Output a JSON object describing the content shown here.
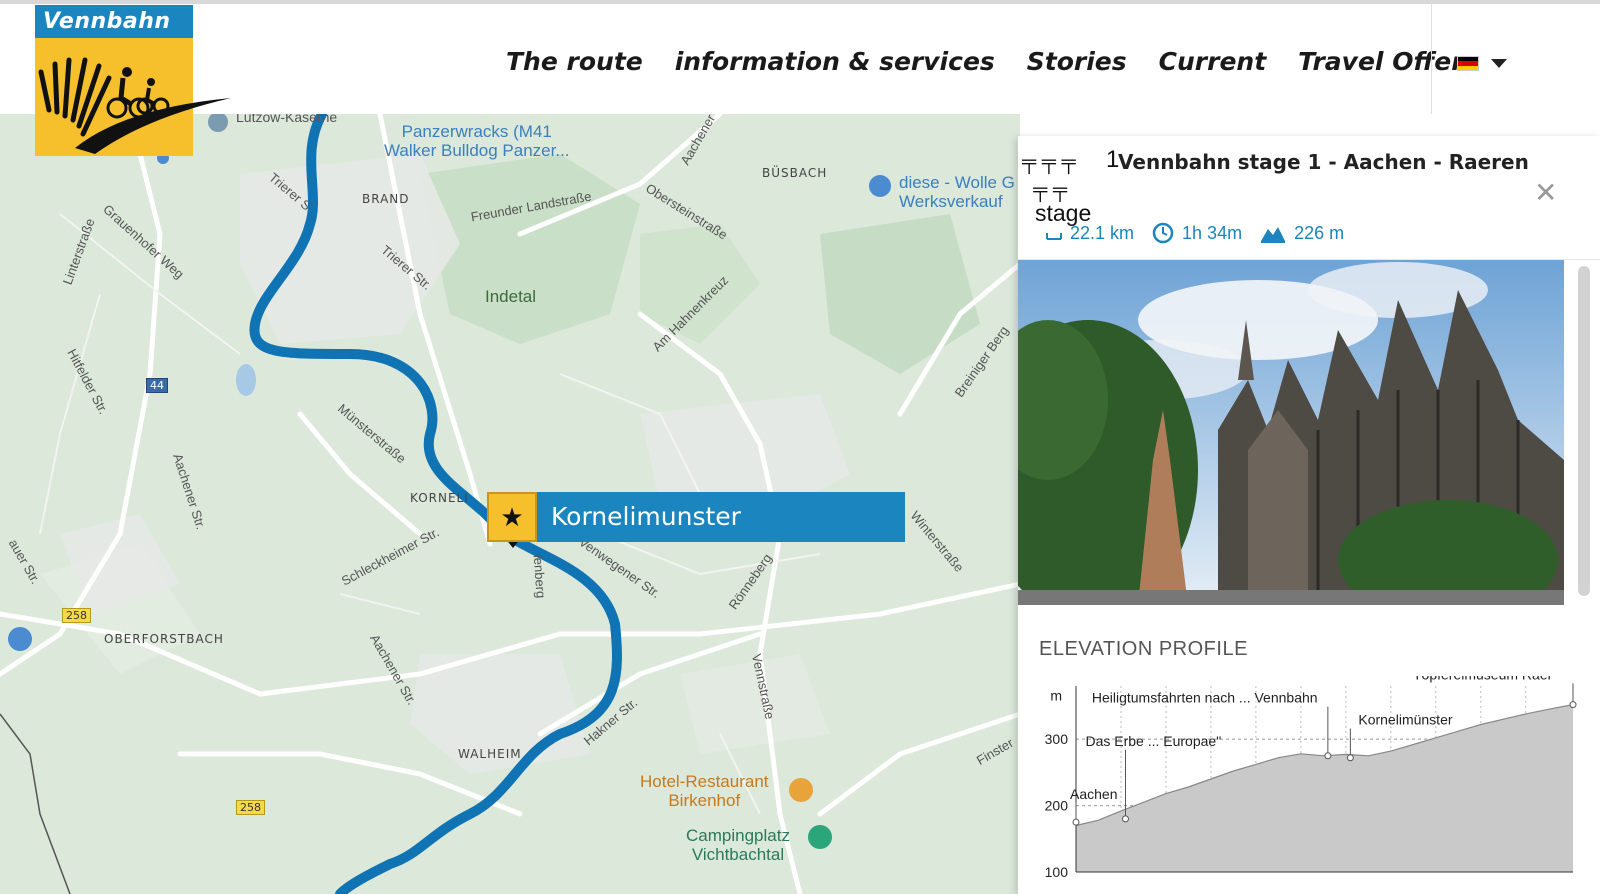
{
  "logo": {
    "text": "Vennbahn"
  },
  "nav": {
    "items": [
      "The route",
      "information & services",
      "Stories",
      "Current",
      "Travel Offers"
    ],
    "language": {
      "flag": "german-flag-icon",
      "colors": [
        "#000000",
        "#dd0000",
        "#ffce00"
      ]
    }
  },
  "map": {
    "labels": {
      "lutzow": "Lützow-Kaserne",
      "panzer": "Panzerwracks (M41\nWalker Bulldog Panzer...",
      "busbach": "BÜSBACH",
      "wolle": "diese - Wolle G\nWerksverkauf",
      "brand": "BRAND",
      "freunder": "Freunder Landstraße",
      "oberstein": "Obersteinstraße",
      "aachener_top": "Aachener",
      "trierer_s": "Trierer S",
      "trierer_str": "Trierer Str.",
      "grauenhofer": "Grauenhofer Weg",
      "linters": "Linterstraße",
      "indetal": "Indetal",
      "hahnen": "Am Hahnenkreuz",
      "breiniger": "Breiniger Berg",
      "hitfelder": "Hitfelder Str.",
      "munster": "Münsterstraße",
      "aachener_left": "Aachener Str.",
      "kornelimunster_area": "KORNELI",
      "venwegener": "Venwegener Str.",
      "schleck": "Schleckheimer Str.",
      "ronneberg": "Rönneberg",
      "winterstr": "Winterstraße",
      "berg": "lenberg",
      "sauer": "auer Str.",
      "oberforstbach": "OBERFORSTBACH",
      "aachener_mid": "Aachener Str.",
      "vennstr": "Vennstraße",
      "hakner": "Hakner Str.",
      "walheim": "WALHEIM",
      "finster": "Finster",
      "hotel": "Hotel-Restaurant\nBirkenhof",
      "camping": "Campingplatz\nVichtbachtal"
    },
    "road_badges": [
      "44",
      "258",
      "258"
    ],
    "marker_label": "Kornelimunster",
    "route_color": "#0f73b4"
  },
  "panel": {
    "stage_number": "1",
    "stage_word": "stage",
    "title": "Vennbahn stage 1 - Aachen - Raeren",
    "stats": {
      "distance": "22.1 km",
      "duration": "1h 34m",
      "ascent": "226 m"
    },
    "elevation_title": "ELEVATION PROFILE"
  },
  "chart_data": {
    "type": "area",
    "title": "ELEVATION PROFILE",
    "ylabel": "m",
    "ylim": [
      100,
      380
    ],
    "yticks": [
      100,
      200,
      300
    ],
    "x_km": [
      0,
      1,
      2,
      3,
      4,
      5,
      6,
      7,
      8,
      9,
      10,
      11,
      12,
      13,
      14,
      15,
      16,
      17,
      18,
      19,
      20,
      21,
      22.1
    ],
    "elevation_m": [
      170,
      178,
      192,
      205,
      218,
      228,
      240,
      252,
      262,
      272,
      278,
      275,
      277,
      275,
      282,
      292,
      302,
      312,
      322,
      330,
      338,
      345,
      352
    ],
    "annotations": [
      {
        "label": "Aachen",
        "x_km": 0,
        "y": 175
      },
      {
        "label": "Das Erbe ... Europae\"",
        "x_km": 2.2,
        "y": 180
      },
      {
        "label": "Heiligtumsfahrten nach ... Vennbahn",
        "x_km": 11.2,
        "y": 275
      },
      {
        "label": "Kornelimünster",
        "x_km": 12.2,
        "y": 272
      },
      {
        "label": "Töpfereimuseum Raer",
        "x_km": 22.1,
        "y": 352
      }
    ],
    "grid": true
  }
}
